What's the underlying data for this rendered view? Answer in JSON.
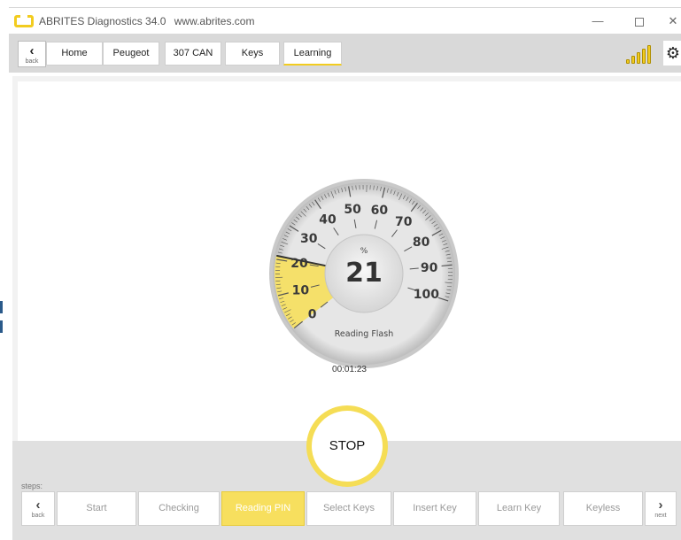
{
  "window": {
    "title": "ABRITES Diagnostics 34.0",
    "url": "www.abrites.com",
    "minimize_glyph": "—",
    "close_glyph": "✕"
  },
  "nav": {
    "back_label": "back",
    "crumbs": [
      "Home",
      "Peugeot",
      "307 CAN",
      "Keys",
      "Learning"
    ],
    "signal_level": 5,
    "settings_icon": "gear-icon",
    "accent_color": "#f2cc1f"
  },
  "gauge": {
    "unit": "%",
    "value": 21,
    "value_text": "21",
    "scale_min": 0,
    "scale_max": 100,
    "scale_labels": [
      "0",
      "10",
      "20",
      "30",
      "40",
      "50",
      "60",
      "70",
      "80",
      "90",
      "100"
    ],
    "caption": "Reading Flash",
    "fill_color": "#f5e06a"
  },
  "timer": "00:01:23",
  "stop_label": "STOP",
  "steps": {
    "label": "steps:",
    "back_label": "back",
    "next_label": "next",
    "items": [
      "Start",
      "Checking",
      "Reading PIN",
      "Select Keys",
      "Insert Key",
      "Learn Key",
      "Keyless"
    ],
    "current_index": 2
  }
}
